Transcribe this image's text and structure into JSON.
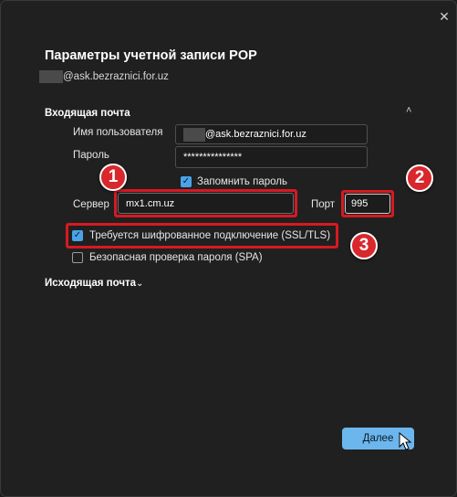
{
  "window": {
    "close_glyph": "✕"
  },
  "dialog": {
    "title": "Параметры учетной записи POP",
    "account_suffix": "@ask.bezraznici.for.uz"
  },
  "incoming": {
    "header": "Входящая почта",
    "collapse_glyph": "˄",
    "username_label": "Имя пользователя",
    "username_suffix": "@ask.bezraznici.for.uz",
    "password_label": "Пароль",
    "password_value": "***************",
    "remember_label": "Запомнить пароль",
    "remember_checked": true,
    "server_label": "Сервер",
    "server_value": "mx1.cm.uz",
    "port_label": "Порт",
    "port_value": "995",
    "ssl_label": "Требуется шифрованное подключение (SSL/TLS)",
    "ssl_checked": true,
    "spa_label": "Безопасная проверка пароля (SPA)",
    "spa_checked": false
  },
  "outgoing": {
    "header": "Исходящая почта",
    "expand_glyph": "⌄"
  },
  "annotations": {
    "badge1": "1",
    "badge2": "2",
    "badge3": "3",
    "color": "#d71921"
  },
  "footer": {
    "next_label": "Далее"
  },
  "colors": {
    "accent": "#6cb6ee",
    "checkbox": "#4aa3e8",
    "background": "#202020"
  }
}
